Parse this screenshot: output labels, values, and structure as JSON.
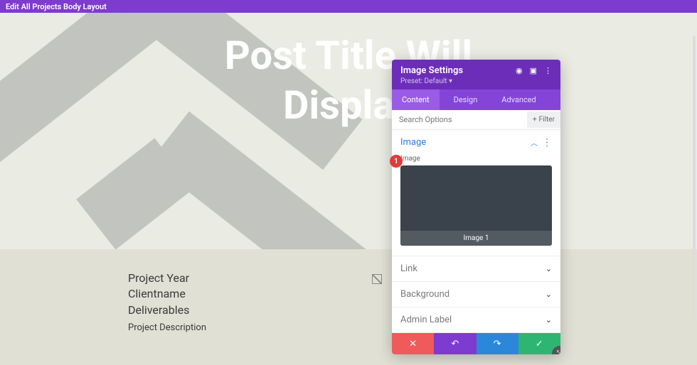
{
  "top_bar": {
    "title": "Edit All Projects Body Layout"
  },
  "hero": {
    "title_line1": "Post Title Will",
    "title_line2": "Display "
  },
  "content": {
    "meta": [
      "Project Year",
      "Clientname",
      "Deliverables"
    ],
    "description": "Project Description"
  },
  "panel": {
    "title": "Image Settings",
    "preset_label": "Preset: Default",
    "tabs": {
      "content": "Content",
      "design": "Design",
      "advanced": "Advanced",
      "active": "content"
    },
    "search": {
      "placeholder": "Search Options",
      "filter_label": "Filter"
    },
    "sections": {
      "image": {
        "title": "Image",
        "field_label": "Image",
        "preview_caption": "Image 1"
      },
      "link": {
        "title": "Link"
      },
      "background": {
        "title": "Background"
      },
      "admin_label": {
        "title": "Admin Label"
      }
    }
  },
  "badge": {
    "number": "1"
  },
  "colors": {
    "purple": "#7e3bd0",
    "blue": "#2e7de9",
    "red": "#ef5a5a",
    "green": "#2fb572"
  }
}
